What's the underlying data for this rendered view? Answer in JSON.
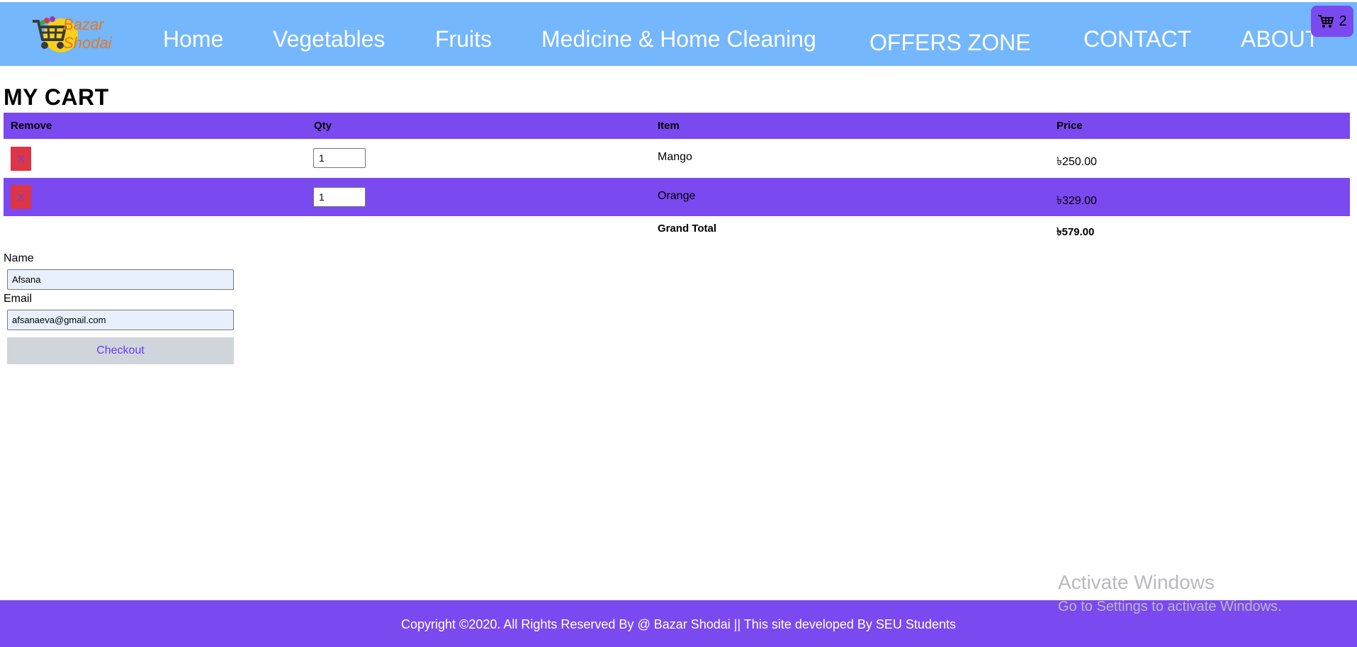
{
  "brand": {
    "logo_line1": "Bazar",
    "logo_line2": "Shodai"
  },
  "nav": {
    "items": [
      {
        "label": "Home"
      },
      {
        "label": "Vegetables"
      },
      {
        "label": "Fruits"
      },
      {
        "label": "Medicine & Home Cleaning"
      },
      {
        "label": "OFFERS ZONE"
      },
      {
        "label": "CONTACT"
      },
      {
        "label": "ABOUT"
      }
    ]
  },
  "cart_badge": {
    "icon": "cart-icon",
    "count": "2"
  },
  "page": {
    "title": "MY CART"
  },
  "table": {
    "headers": {
      "remove": "Remove",
      "qty": "Qty",
      "item": "Item",
      "price": "Price"
    },
    "rows": [
      {
        "remove_label": "X",
        "qty": "1",
        "item": "Mango",
        "price": "৳250.00"
      },
      {
        "remove_label": "X",
        "qty": "1",
        "item": "Orange",
        "price": "৳329.00"
      }
    ],
    "grand_total_label": "Grand Total",
    "grand_total_value": "৳579.00"
  },
  "form": {
    "name_label": "Name",
    "name_value": "Afsana",
    "email_label": "Email",
    "email_value": "afsanaeva@gmail.com",
    "checkout_label": "Checkout"
  },
  "watermark": {
    "line1": "Activate Windows",
    "line2": "Go to Settings to activate Windows."
  },
  "footer": {
    "text": "Copyright ©2020. All Rights Reserved By @ Bazar Shodai || This site developed By SEU Students"
  },
  "colors": {
    "header_bg": "#74b7fc",
    "accent_purple": "#7b49f0",
    "remove_red": "#dc3545",
    "logo_orange": "#e8771f"
  }
}
